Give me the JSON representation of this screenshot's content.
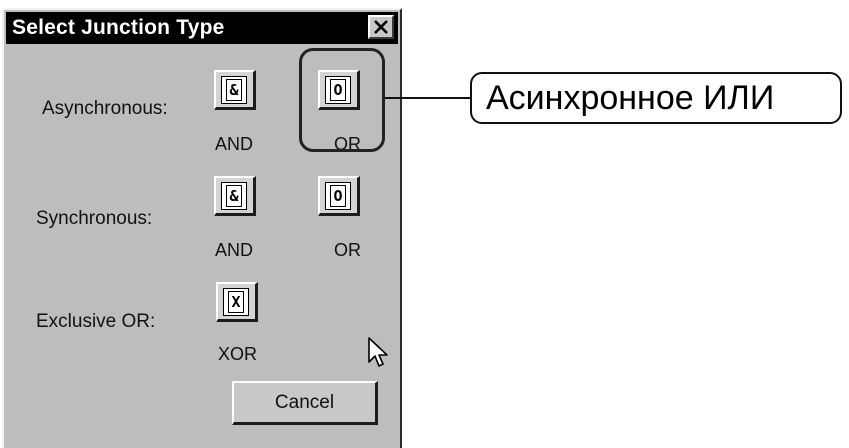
{
  "dialog": {
    "title": "Select Junction Type",
    "close_glyph": "✕",
    "rows": [
      {
        "label": "Asynchronous:",
        "buttons": [
          {
            "symbol": "&",
            "caption": "AND",
            "icon": "async-and-icon"
          },
          {
            "symbol": "O",
            "caption": "OR",
            "icon": "async-or-icon"
          }
        ]
      },
      {
        "label": "Synchronous:",
        "buttons": [
          {
            "symbol": "&",
            "caption": "AND",
            "icon": "sync-and-icon"
          },
          {
            "symbol": "O",
            "caption": "OR",
            "icon": "sync-or-icon"
          }
        ]
      },
      {
        "label": "Exclusive OR:",
        "buttons": [
          {
            "symbol": "X",
            "caption": "XOR",
            "icon": "xor-icon"
          }
        ]
      }
    ],
    "cancel_label": "Cancel"
  },
  "annotation": {
    "callout_text": "Асинхронное ИЛИ"
  },
  "cursor": {
    "icon": "arrow-cursor-icon"
  },
  "colors": {
    "dialog_bg": "#bdbdbd",
    "titlebar_bg": "#000000",
    "titlebar_text": "#ffffff"
  }
}
